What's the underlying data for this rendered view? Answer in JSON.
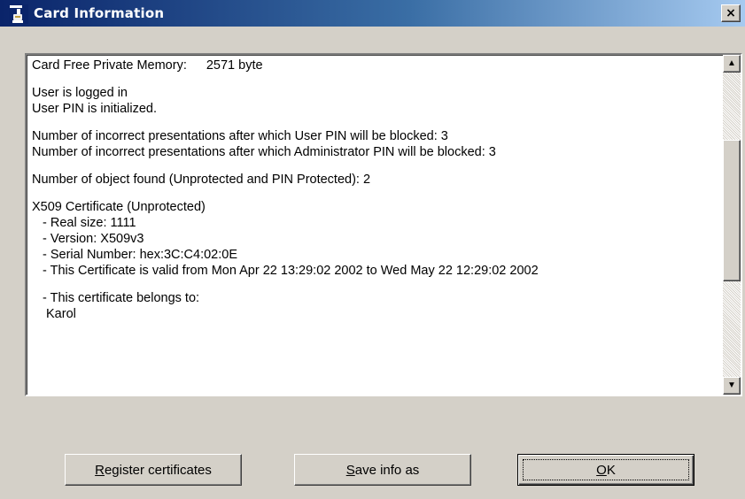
{
  "window": {
    "title": "Card Information",
    "icon": "smartcard-app-icon",
    "close_label": "×",
    "colors": {
      "titlebar_start": "#0a246a",
      "titlebar_end": "#a6caf0",
      "face": "#d4d0c8"
    }
  },
  "info": {
    "memory_label": "Card Free Private Memory:",
    "memory_value": "2571 byte",
    "logged_in": "User is logged in",
    "pin_initialized": "User PIN is initialized.",
    "user_pin_attempts": "Number of incorrect presentations after which User PIN will be blocked: 3",
    "admin_pin_attempts": "Number of incorrect presentations after which Administrator PIN will be blocked: 3",
    "objects_found": "Number of object found (Unprotected and PIN Protected): 2",
    "cert_header": "X509 Certificate (Unprotected)",
    "real_size": "- Real size: 1111",
    "version": "- Version: X509v3",
    "serial": "- Serial Number: hex:3C:C4:02:0E",
    "validity": "- This Certificate is valid from Mon Apr 22 13:29:02 2002 to Wed May 22 12:29:02 2002",
    "belongs_to": "- This certificate belongs to:",
    "owner": "Karol"
  },
  "scrollbar": {
    "up_icon": "arrow-up-icon",
    "down_icon": "arrow-down-icon",
    "up_glyph": "▲",
    "down_glyph": "▼"
  },
  "buttons": {
    "register": {
      "mnemonic": "R",
      "rest": "egister certificates"
    },
    "save": {
      "mnemonic": "S",
      "rest": "ave info as"
    },
    "ok": {
      "mnemonic": "O",
      "rest": "K"
    }
  }
}
